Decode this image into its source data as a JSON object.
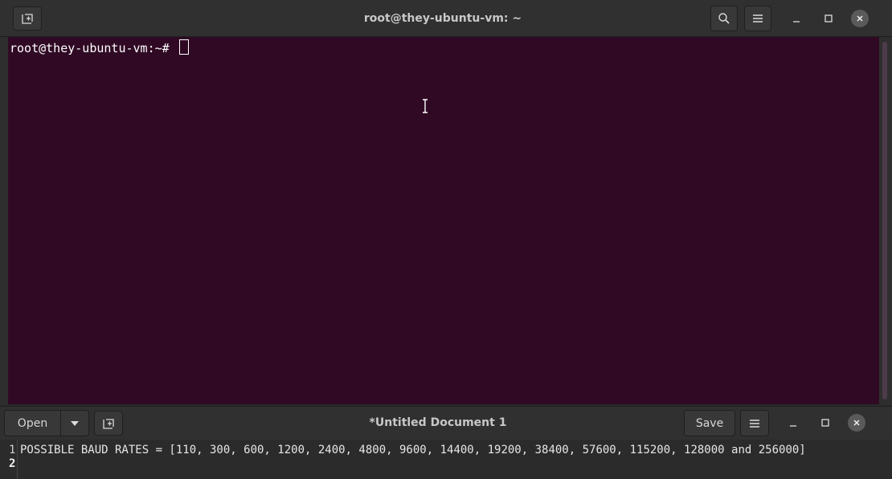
{
  "terminal": {
    "title": "root@they-ubuntu-vm: ~",
    "prompt": "root@they-ubuntu-vm:~# ",
    "icons": {
      "new_tab": "new-tab-icon",
      "search": "search-icon",
      "menu": "hamburger-menu-icon",
      "minimize": "minimize-icon",
      "maximize": "maximize-icon",
      "close": "close-icon"
    },
    "colors": {
      "background": "#300a24",
      "text": "#ffffff"
    }
  },
  "editor": {
    "title": "*Untitled Document 1",
    "open_label": "Open",
    "save_label": "Save",
    "lines": [
      {
        "number": "1",
        "text": "POSSIBLE BAUD RATES = [110, 300, 600, 1200, 2400, 4800, 9600, 14400, 19200, 38400, 57600, 115200, 128000 and 256000]"
      },
      {
        "number": "2",
        "text": ""
      }
    ]
  }
}
